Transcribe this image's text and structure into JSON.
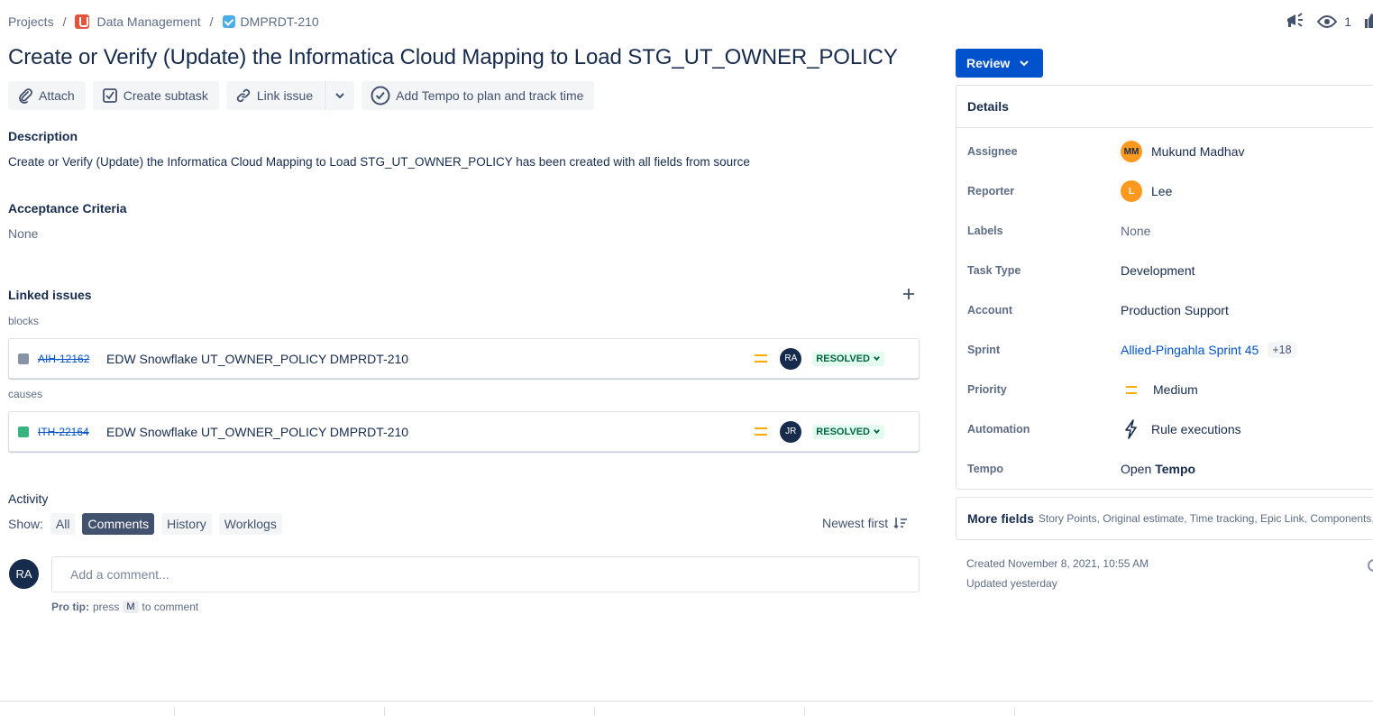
{
  "breadcrumb": {
    "projects": "Projects",
    "project_name": "Data Management",
    "issue_key": "DMPRDT-210"
  },
  "header": {
    "watch_count": "1"
  },
  "issue": {
    "title": "Create or Verify (Update) the Informatica Cloud Mapping to Load STG_UT_OWNER_POLICY"
  },
  "actions": {
    "attach": "Attach",
    "create_subtask": "Create subtask",
    "link_issue": "Link issue",
    "tempo": "Add Tempo to plan and track time"
  },
  "description": {
    "label": "Description",
    "text": "Create or Verify (Update) the Informatica Cloud Mapping to Load STG_UT_OWNER_POLICY has been created with all fields from source"
  },
  "acceptance": {
    "label": "Acceptance Criteria",
    "text": "None"
  },
  "linked": {
    "label": "Linked issues",
    "groups": [
      {
        "relation": "blocks",
        "key": "AIH-12162",
        "summary": "EDW Snowflake UT_OWNER_POLICY DMPRDT-210",
        "assignee": "RA",
        "status": "RESOLVED"
      },
      {
        "relation": "causes",
        "key": "ITH-22164",
        "summary": "EDW Snowflake UT_OWNER_POLICY DMPRDT-210",
        "assignee": "JR",
        "status": "RESOLVED"
      }
    ]
  },
  "activity": {
    "label": "Activity",
    "show": "Show:",
    "filters": [
      "All",
      "Comments",
      "History",
      "Worklogs"
    ],
    "active_filter": "Comments",
    "sort": "Newest first",
    "user_initials": "RA",
    "comment_placeholder": "Add a comment...",
    "pro_tip_label": "Pro tip:",
    "pro_tip_press": "press",
    "pro_tip_key": "M",
    "pro_tip_suffix": "to comment"
  },
  "status_button": "Review",
  "details": {
    "title": "Details",
    "assignee_label": "Assignee",
    "assignee_initials": "MM",
    "assignee": "Mukund Madhav",
    "reporter_label": "Reporter",
    "reporter_initials": "L",
    "reporter": "Lee",
    "labels_label": "Labels",
    "labels": "None",
    "task_type_label": "Task Type",
    "task_type": "Development",
    "account_label": "Account",
    "account": "Production Support",
    "sprint_label": "Sprint",
    "sprint": "Allied-Pingahla Sprint 45",
    "sprint_more": "+18",
    "priority_label": "Priority",
    "priority": "Medium",
    "automation_label": "Automation",
    "automation": "Rule executions",
    "tempo_label": "Tempo",
    "tempo_open": "Open",
    "tempo_name": "Tempo"
  },
  "more_fields": {
    "title": "More fields",
    "list": "Story Points, Original estimate, Time tracking, Epic Link, Components, F"
  },
  "meta": {
    "created": "Created November 8, 2021, 10:55 AM",
    "updated": "Updated yesterday"
  },
  "colors": {
    "primary": "#0052cc",
    "resolved_bg": "#e3fcef",
    "resolved_text": "#006644",
    "priority_medium": "#ffab00",
    "avatar_dark": "#172b4d",
    "avatar_orange": "#ff991f"
  }
}
